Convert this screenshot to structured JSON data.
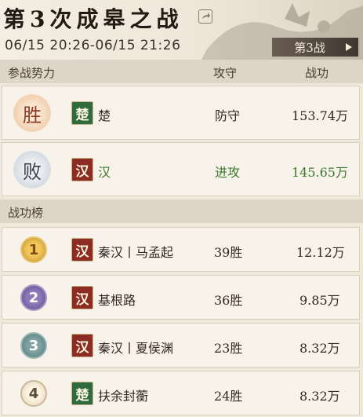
{
  "header": {
    "title": "第3次成皋之战",
    "time_range": "06/15 20:26-06/15 21:26",
    "battle_button": "第3战"
  },
  "factions_header": {
    "col_force": "参战势力",
    "col_side": "攻守",
    "col_merit": "战功"
  },
  "factions": [
    {
      "result": "胜",
      "badge": "楚",
      "badge_color": "#2f6b3c",
      "name": "楚",
      "side": "防守",
      "merit": "153.74万"
    },
    {
      "result": "败",
      "badge": "汉",
      "badge_color": "#8c2c22",
      "name": "汉",
      "side": "进攻",
      "merit": "145.65万"
    }
  ],
  "ranking_header": "战功榜",
  "ranking": [
    {
      "rank": "1",
      "badge": "汉",
      "name": "秦汉丨马孟起",
      "wins": "39胜",
      "merit": "12.12万"
    },
    {
      "rank": "2",
      "badge": "汉",
      "name": "基根路",
      "wins": "36胜",
      "merit": "9.85万"
    },
    {
      "rank": "3",
      "badge": "汉",
      "name": "秦汉丨夏侯渊",
      "wins": "23胜",
      "merit": "8.32万"
    },
    {
      "rank": "4",
      "badge": "楚",
      "name": "扶余封蘅",
      "wins": "24胜",
      "merit": "8.32万"
    }
  ],
  "colors": {
    "chu": "#2f6b3c",
    "han": "#8c2c22",
    "attack_text": "#3c7a2c"
  }
}
